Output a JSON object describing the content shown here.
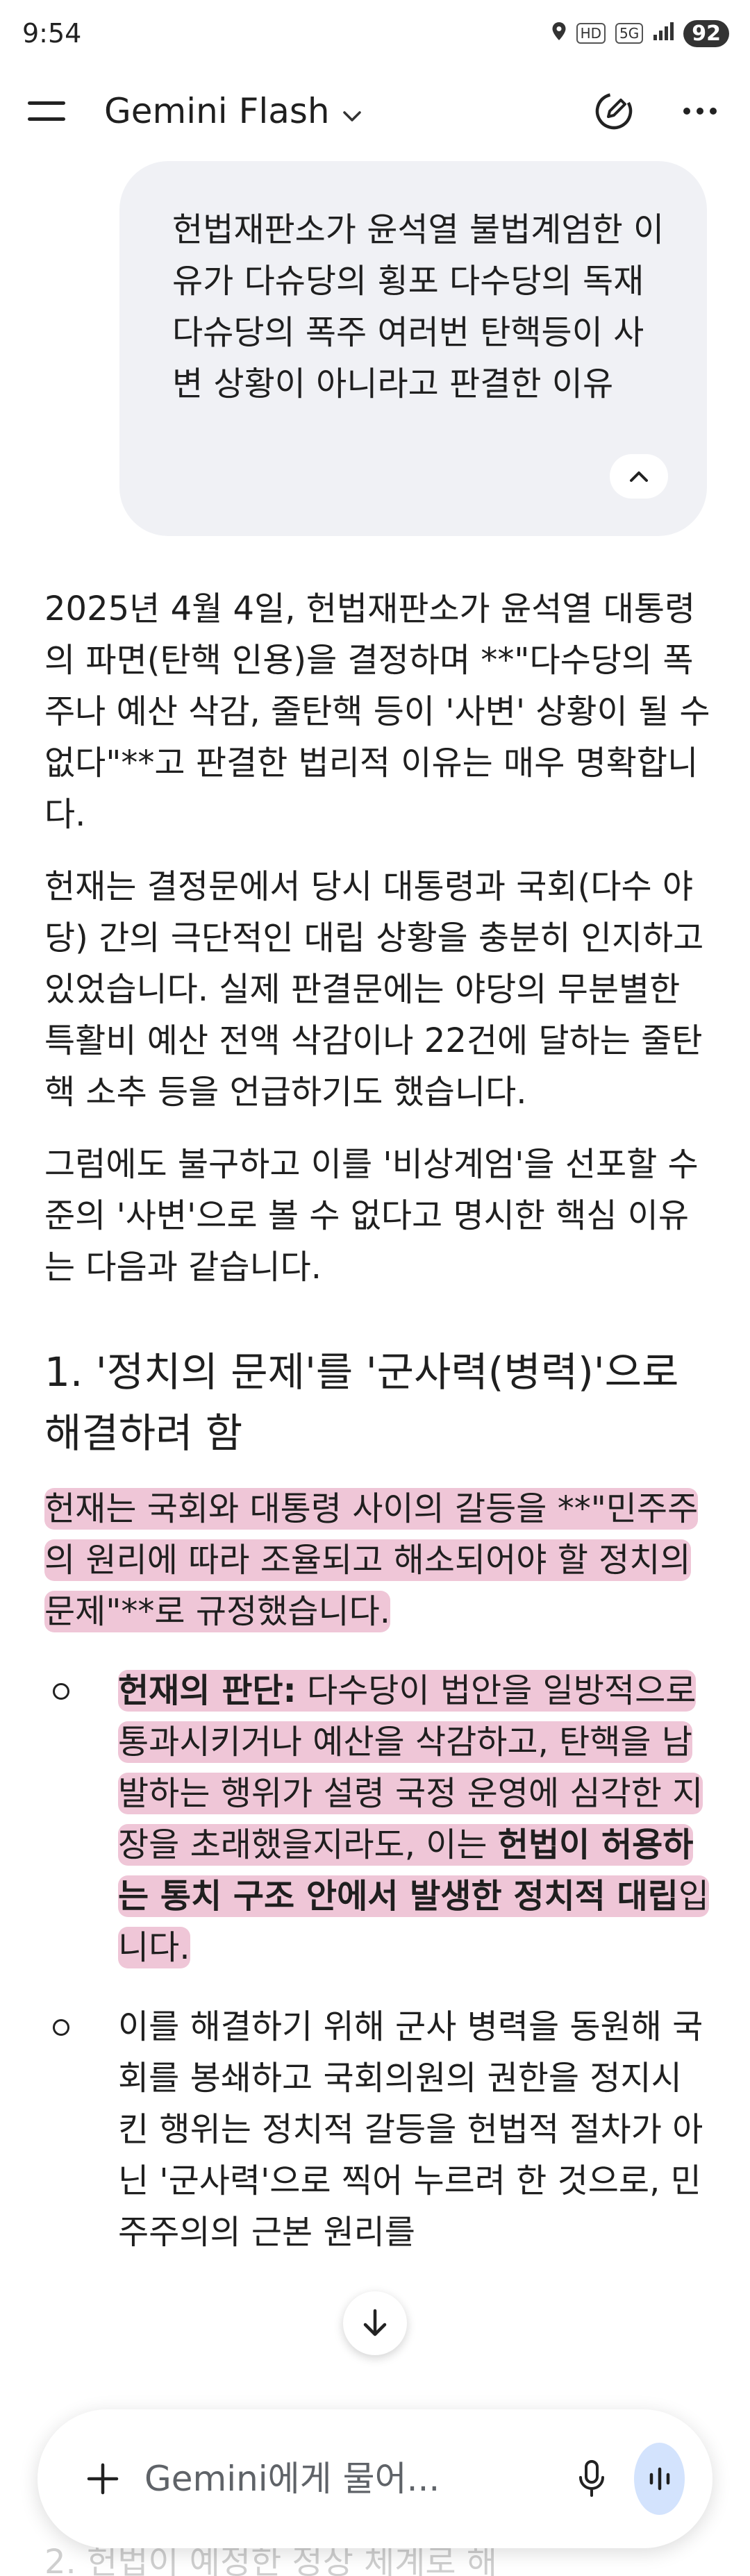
{
  "status_bar": {
    "time": "9:54",
    "hd_label": "HD",
    "network_label": "5G",
    "battery": "92"
  },
  "app_bar": {
    "title": "Gemini Flash"
  },
  "user_prompt": {
    "text": "헌법재판소가 윤석열 불법계엄한 이유가 다슈당의 횡포 다수당의 독재 다슈당의 폭주 여러번 탄핵등이 사변 상황이 아니라고 판결한 이유"
  },
  "response": {
    "intro_paragraphs": [
      "2025년 4월 4일, 헌법재판소가 윤석열 대통령의 파면(탄핵 인용)을 결정하며 **\"다수당의 폭주나 예산 삭감, 줄탄핵 등이 '사변' 상황이 될 수 없다\"**고 판결한 법리적 이유는 매우 명확합니다.",
      "헌재는 결정문에서 당시 대통령과 국회(다수 야당) 간의 극단적인 대립 상황을 충분히 인지하고 있었습니다. 실제 판결문에는 야당의 무분별한 특활비 예산 전액 삭감이나 22건에 달하는 줄탄핵 소추 등을 언급하기도 했습니다.",
      "그럼에도 불구하고 이를 '비상계엄'을 선포할 수준의 '사변'으로 볼 수 없다고 명시한 핵심 이유는 다음과 같습니다."
    ],
    "section1": {
      "heading": "1. '정치의 문제'를 '군사력(병력)'으로 해결하려 함",
      "paragraph": "헌재는 국회와 대통령 사이의 갈등을 **\"민주주의 원리에 따라 조율되고 해소되어야 할 정치의 문제\"**로 규정했습니다.",
      "bullet1": {
        "label": "헌재의 판단:",
        "text_a": " 다수당이 법안을 일방적으로 통과시키거나 예산을 삭감하고, 탄핵을 남발하는 행위가 설령 국정 운영에 심각한 지장을 초래했을지라도, 이는 ",
        "bold": "헌법이 허용하는 통치 구조 안에서 발생한 정치적 대립",
        "text_b": "입니다."
      },
      "bullet2": {
        "text": "이를 해결하기 위해 군사 병력을 동원해 국회를 봉쇄하고 국회의원의 권한을 정지시킨 행위는 정치적 갈등을 헌법적 절차가 아닌 '군사력'으로 찍어 누르려 한 것으로, 민주주의의 근본 원리를"
      }
    },
    "below_fold_text": "2. 헌법이 예정한 정상 체계로 해"
  },
  "input_bar": {
    "placeholder": "Gemini에게 물어..."
  },
  "colors": {
    "highlight": "#d66996",
    "voice_button_bg": "#d3e3fd",
    "bubble_bg": "#f0f1f5"
  }
}
